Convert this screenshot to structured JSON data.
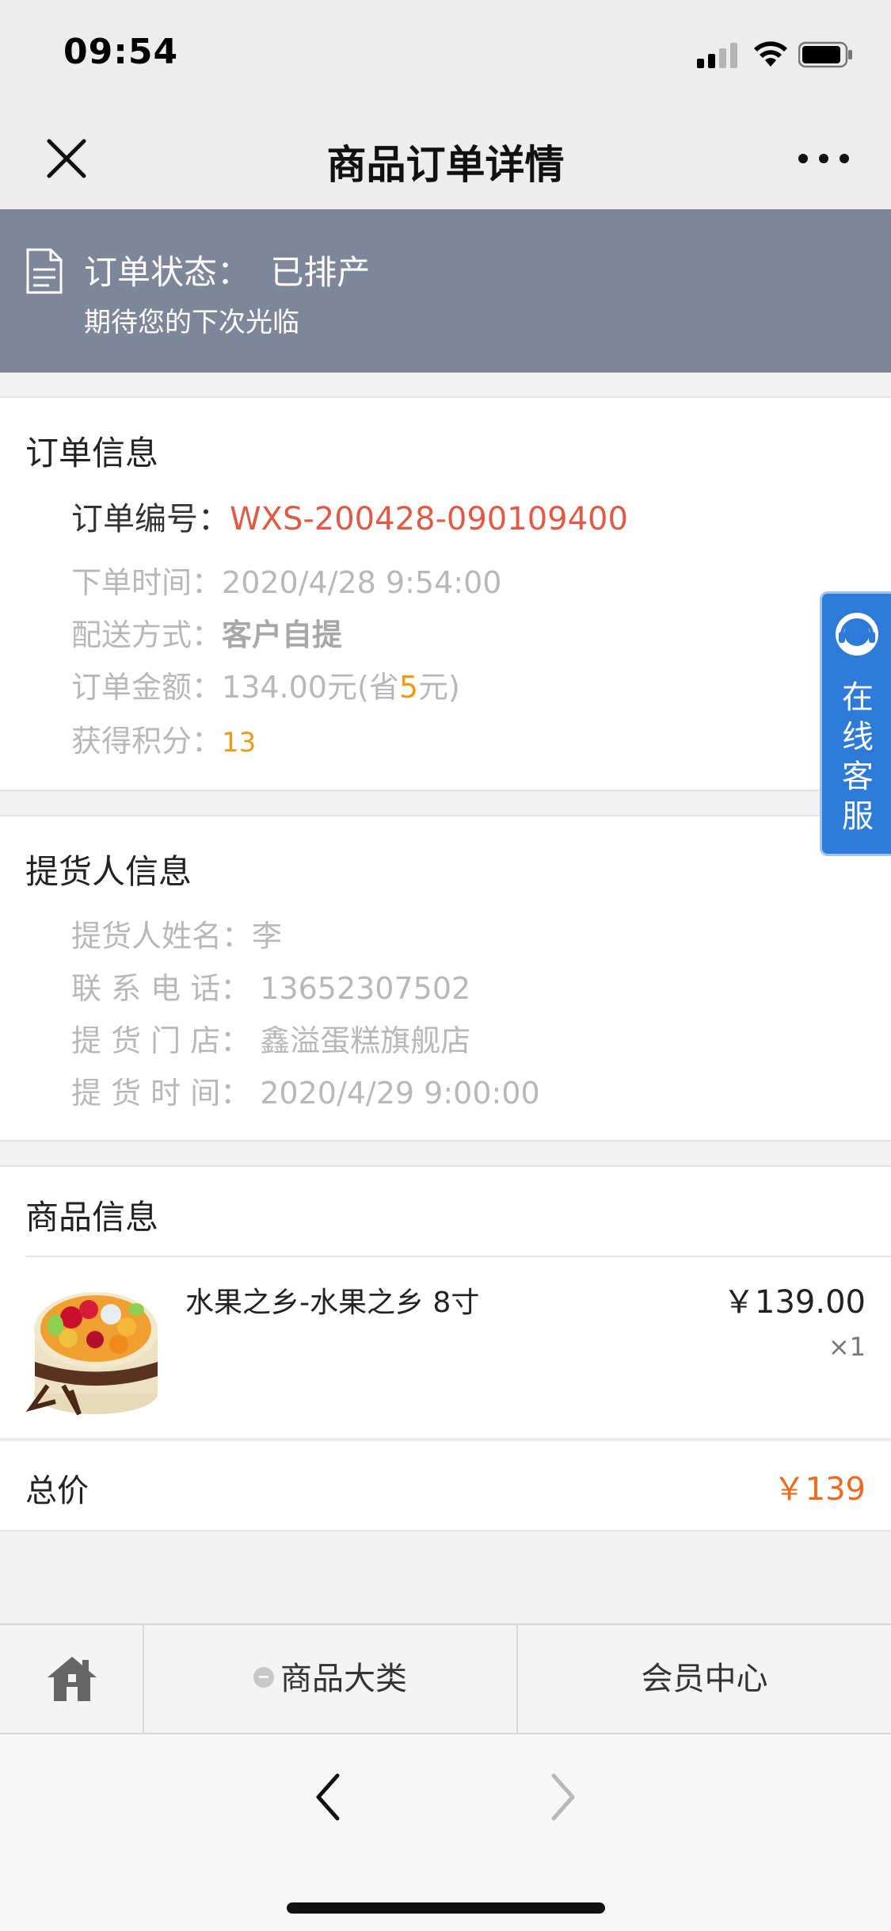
{
  "status_bar": {
    "time": "09:54"
  },
  "nav": {
    "title": "商品订单详情"
  },
  "banner": {
    "status_label": "订单状态：",
    "status_value": "已排产",
    "subtitle": "期待您的下次光临"
  },
  "order_info": {
    "title": "订单信息",
    "number_label": "订单编号：",
    "number_value": "WXS-200428-090109400",
    "time_label": "下单时间：",
    "time_value": "2020/4/28 9:54:00",
    "delivery_label": "配送方式：",
    "delivery_value": "客户自提",
    "amount_label": "订单金额：",
    "amount_value": "134.00元(省",
    "amount_saved": "5",
    "amount_suffix": "元)",
    "points_label": "获得积分：",
    "points_value": "13"
  },
  "pickup_info": {
    "title": "提货人信息",
    "name_label": "提货人姓名：",
    "name_value": "李",
    "phone_label": "联 系 电 话：",
    "phone_value": "13652307502",
    "store_label": "提 货 门 店：",
    "store_value": "鑫溢蛋糕旗舰店",
    "time_label": "提 货 时 间：",
    "time_value": "2020/4/29 9:00:00"
  },
  "goods_info": {
    "title": "商品信息",
    "items": [
      {
        "name": "水果之乡-水果之乡 8寸",
        "price": "￥139.00",
        "qty": "×1"
      }
    ],
    "total_label": "总价",
    "total_value": "￥139"
  },
  "service_tab": {
    "label": "在线客服"
  },
  "bottom_menu": {
    "home_icon": "home-icon",
    "category_label": "商品大类",
    "member_label": "会员中心"
  },
  "colors": {
    "banner_bg": "#7e8799",
    "red": "#e05a45",
    "orange": "#f09a1a",
    "price_orange": "#ef6a1f",
    "service_blue": "#2e7ad8"
  }
}
